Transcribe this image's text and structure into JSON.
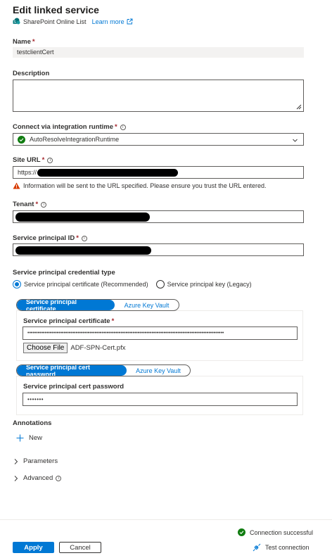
{
  "header": {
    "title": "Edit linked service",
    "service_type": "SharePoint Online List",
    "learn_more": "Learn more"
  },
  "name": {
    "label": "Name",
    "required": "*",
    "value": "testclientCert"
  },
  "description": {
    "label": "Description",
    "value": ""
  },
  "runtime": {
    "label": "Connect via integration runtime",
    "required": "*",
    "info": "i",
    "value": "AutoResolveIntegrationRuntime"
  },
  "site_url": {
    "label": "Site URL",
    "required": "*",
    "info": "i",
    "value": "https://",
    "warning": "Information will be sent to the URL specified. Please ensure you trust the URL entered."
  },
  "tenant": {
    "label": "Tenant",
    "required": "*",
    "info": "i",
    "value": ""
  },
  "service_principal_id": {
    "label": "Service principal ID",
    "required": "*",
    "info": "i",
    "value": ""
  },
  "credential_type": {
    "label": "Service principal credential type",
    "options": [
      "Service principal certificate (Recommended)",
      "Service principal key (Legacy)"
    ],
    "selected": 0
  },
  "cert_section": {
    "toggle": [
      "Service principal certificate",
      "Azure Key Vault"
    ],
    "field_label": "Service principal certificate",
    "required": "*",
    "value": "••••••••••••••••••••••••••••••••••••••••••••••••••••••••••••••••••••••••••••••••••••••••••••••••••••••••••••••••••",
    "choose_file": "Choose File",
    "file_name": "ADF-SPN-Cert.pfx"
  },
  "password_section": {
    "toggle": [
      "Service principal cert password",
      "Azure Key Vault"
    ],
    "field_label": "Service principal cert password",
    "value": "•••••••"
  },
  "annotations": {
    "label": "Annotations",
    "new": "New"
  },
  "parameters": {
    "label": "Parameters"
  },
  "advanced": {
    "label": "Advanced",
    "info": "i"
  },
  "footer": {
    "status": "Connection successful",
    "test": "Test connection",
    "apply": "Apply",
    "cancel": "Cancel"
  },
  "colors": {
    "accent": "#0078d4",
    "success": "#107c10",
    "warning": "#d83b01",
    "required": "#a4262c"
  }
}
